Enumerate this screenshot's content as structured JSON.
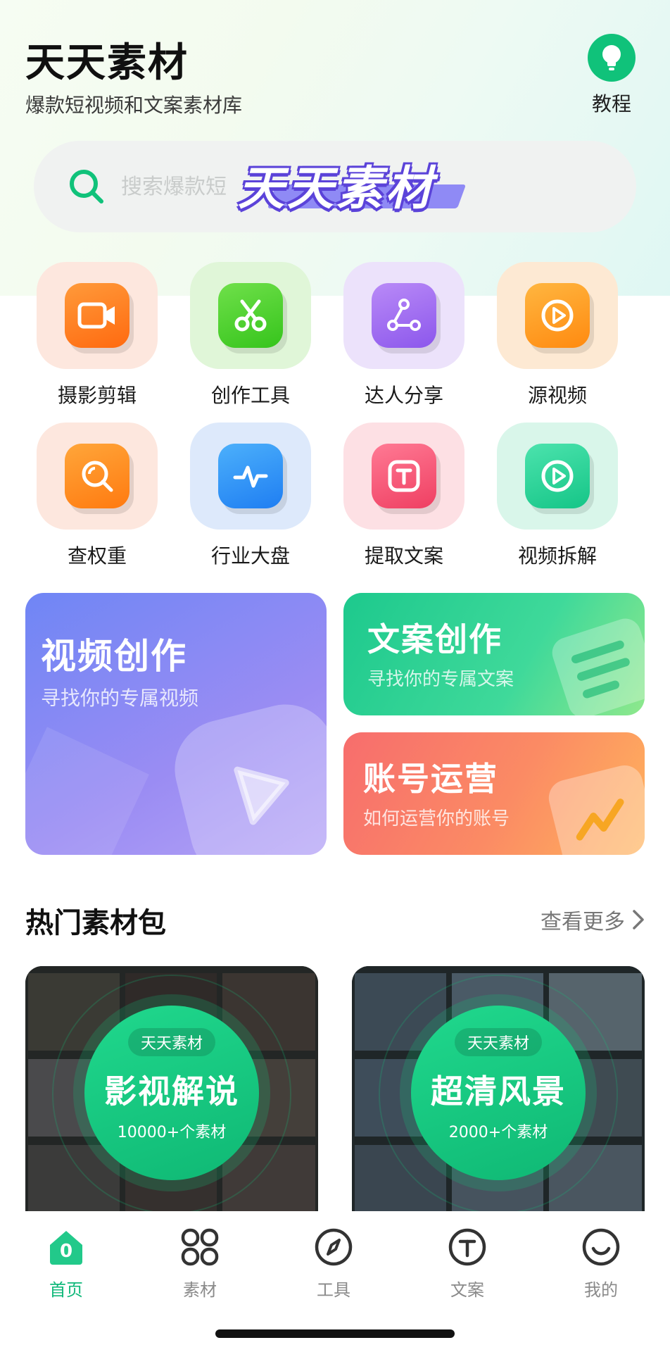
{
  "header": {
    "title": "天天素材",
    "subtitle": "爆款短视频和文案素材库",
    "tutorial_label": "教程"
  },
  "search": {
    "placeholder": "搜索爆款短",
    "overlay_text": "天天素材"
  },
  "grid": {
    "items": [
      {
        "label": "摄影剪辑",
        "icon": "video-camera-icon",
        "color": "#ff7a1a"
      },
      {
        "label": "创作工具",
        "icon": "scissors-icon",
        "color": "#4cd430"
      },
      {
        "label": "达人分享",
        "icon": "share-icon",
        "color": "#a06cf0"
      },
      {
        "label": "源视频",
        "icon": "play-circle-icon",
        "color": "#ff9a10"
      },
      {
        "label": "查权重",
        "icon": "search-icon",
        "color": "#ff8a10"
      },
      {
        "label": "行业大盘",
        "icon": "pulse-icon",
        "color": "#2f8df7"
      },
      {
        "label": "提取文案",
        "icon": "text-box-icon",
        "color": "#f55575"
      },
      {
        "label": "视频拆解",
        "icon": "play-circle-icon",
        "color": "#2bd39a"
      }
    ]
  },
  "cards": {
    "video": {
      "title": "视频创作",
      "subtitle": "寻找你的专属视频"
    },
    "copy": {
      "title": "文案创作",
      "subtitle": "寻找你的专属文案"
    },
    "account": {
      "title": "账号运营",
      "subtitle": "如何运营你的账号"
    }
  },
  "section": {
    "title": "热门素材包",
    "more": "查看更多"
  },
  "packs": [
    {
      "badge": "天天素材",
      "title": "影视解说",
      "count": "10000+个素材"
    },
    {
      "badge": "天天素材",
      "title": "超清风景",
      "count": "2000+个素材"
    }
  ],
  "tabbar": {
    "tabs": [
      {
        "label": "首页",
        "icon": "home-icon",
        "active": true
      },
      {
        "label": "素材",
        "icon": "grid-icon",
        "active": false
      },
      {
        "label": "工具",
        "icon": "compass-icon",
        "active": false
      },
      {
        "label": "文案",
        "icon": "text-circle-icon",
        "active": false
      },
      {
        "label": "我的",
        "icon": "smile-icon",
        "active": false
      }
    ],
    "home_badge": "0"
  },
  "colors": {
    "accent": "#10c27a",
    "video_card_from": "#6f86f5",
    "copy_card_from": "#1dc98d",
    "account_card_from": "#f76d6d"
  }
}
